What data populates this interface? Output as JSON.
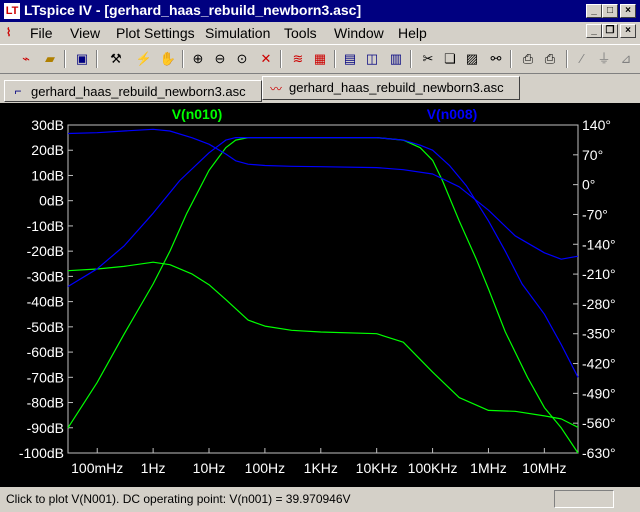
{
  "window": {
    "title": "LTspice IV - [gerhard_haas_rebuild_newborn3.asc]",
    "app_icon": "ltspice-logo-icon"
  },
  "menu": {
    "items": [
      {
        "label": "File"
      },
      {
        "label": "View"
      },
      {
        "label": "Plot Settings"
      },
      {
        "label": "Simulation"
      },
      {
        "label": "Tools"
      },
      {
        "label": "Window"
      },
      {
        "label": "Help"
      }
    ]
  },
  "toolbar": {
    "icons": [
      "new-schematic-icon",
      "open-icon",
      "save-icon",
      "control-panel-icon",
      "run-icon",
      "halt-icon",
      "zoom-in-icon",
      "zoom-out-icon",
      "zoom-back-icon",
      "zoom-extents-icon",
      "autorange-icon",
      "grid-icon",
      "tile-horizontal-icon",
      "cascade-icon",
      "tile-vertical-icon",
      "cut-icon",
      "copy-icon",
      "paste-icon",
      "find-icon",
      "print-setup-icon",
      "print-icon",
      "draw-wire-icon",
      "ground-icon",
      "label-net-icon"
    ]
  },
  "tabs": [
    {
      "label": "gerhard_haas_rebuild_newborn3.asc",
      "icon": "schematic-icon",
      "active": false
    },
    {
      "label": "gerhard_haas_rebuild_newborn3.asc",
      "icon": "waveform-icon",
      "active": true
    }
  ],
  "status": {
    "text": "Click to plot V(N001).  DC operating point: V(n001) = 39.970946V"
  },
  "colors": {
    "plot_background": "#000000",
    "axis_text": "#ffffff",
    "series_green": "#00ff00",
    "series_blue": "#0000ff",
    "title_bar": "#000080"
  },
  "chart_data": {
    "type": "line",
    "xscale": "log",
    "xlim": [
      0.03,
      40000000
    ],
    "ylim": [
      -100,
      30
    ],
    "y2lim": [
      -630,
      140
    ],
    "x_ticks": [
      {
        "v": 0.1,
        "label": "100mHz"
      },
      {
        "v": 1,
        "label": "1Hz"
      },
      {
        "v": 10,
        "label": "10Hz"
      },
      {
        "v": 100,
        "label": "100Hz"
      },
      {
        "v": 1000,
        "label": "1KHz"
      },
      {
        "v": 10000,
        "label": "10KHz"
      },
      {
        "v": 100000,
        "label": "100KHz"
      },
      {
        "v": 1000000,
        "label": "1MHz"
      },
      {
        "v": 10000000,
        "label": "10MHz"
      }
    ],
    "y_ticks": [
      {
        "v": 30,
        "label": "30dB"
      },
      {
        "v": 20,
        "label": "20dB"
      },
      {
        "v": 10,
        "label": "10dB"
      },
      {
        "v": 0,
        "label": "0dB"
      },
      {
        "v": -10,
        "label": "-10dB"
      },
      {
        "v": -20,
        "label": "-20dB"
      },
      {
        "v": -30,
        "label": "-30dB"
      },
      {
        "v": -40,
        "label": "-40dB"
      },
      {
        "v": -50,
        "label": "-50dB"
      },
      {
        "v": -60,
        "label": "-60dB"
      },
      {
        "v": -70,
        "label": "-70dB"
      },
      {
        "v": -80,
        "label": "-80dB"
      },
      {
        "v": -90,
        "label": "-90dB"
      },
      {
        "v": -100,
        "label": "-100dB"
      }
    ],
    "y2_ticks": [
      {
        "v": 140,
        "label": "140°"
      },
      {
        "v": 70,
        "label": "70°"
      },
      {
        "v": 0,
        "label": "0°"
      },
      {
        "v": -70,
        "label": "-70°"
      },
      {
        "v": -140,
        "label": "-140°"
      },
      {
        "v": -210,
        "label": "-210°"
      },
      {
        "v": -280,
        "label": "-280°"
      },
      {
        "v": -350,
        "label": "-350°"
      },
      {
        "v": -420,
        "label": "-420°"
      },
      {
        "v": -490,
        "label": "-490°"
      },
      {
        "v": -560,
        "label": "-560°"
      },
      {
        "v": -630,
        "label": "-630°"
      }
    ],
    "series": [
      {
        "name": "V(n010)",
        "color": "#00ff00",
        "magnitude": {
          "x": [
            0.03,
            0.1,
            0.3,
            1,
            2,
            4,
            10,
            20,
            30,
            50,
            100,
            300,
            1000,
            10000,
            30000,
            60000,
            100000,
            150000,
            300000,
            600000,
            1000000,
            2000000,
            5000000,
            10000000,
            20000000,
            40000000
          ],
          "y": [
            -90,
            -72,
            -53,
            -33,
            -20,
            -5,
            12,
            21,
            24,
            25,
            25,
            25,
            25,
            25,
            24,
            21,
            16,
            8,
            -8,
            -23,
            -35,
            -52,
            -70,
            -82,
            -90,
            -100
          ]
        },
        "phase": {
          "x": [
            0.03,
            0.1,
            0.3,
            1,
            2,
            5,
            10,
            20,
            50,
            100,
            300,
            1000,
            10000,
            30000,
            100000,
            300000,
            1000000,
            3000000,
            10000000,
            20000000,
            40000000
          ],
          "y": [
            -202,
            -198,
            -192,
            -182,
            -188,
            -210,
            -235,
            -270,
            -318,
            -332,
            -342,
            -346,
            -350,
            -370,
            -440,
            -500,
            -530,
            -532,
            -543,
            -550,
            -570
          ]
        }
      },
      {
        "name": "V(n008)",
        "color": "#0000ff",
        "magnitude": {
          "x": [
            0.03,
            0.1,
            0.3,
            1,
            3,
            10,
            20,
            30,
            50,
            100,
            300,
            1000,
            10000,
            30000,
            60000,
            100000,
            200000,
            400000,
            1000000,
            2000000,
            4000000,
            10000000,
            20000000,
            40000000
          ],
          "y": [
            -34,
            -27,
            -18,
            -5,
            8,
            19,
            24,
            25,
            25,
            25,
            25,
            25,
            25,
            24,
            22,
            20,
            14,
            6,
            -8,
            -20,
            -33,
            -45,
            -57,
            -70
          ]
        },
        "phase": {
          "x": [
            0.03,
            0.1,
            0.3,
            1,
            2,
            5,
            10,
            20,
            30,
            50,
            100,
            300,
            1000,
            10000,
            30000,
            100000,
            300000,
            1000000,
            3000000,
            10000000,
            20000000,
            40000000
          ],
          "y": [
            120,
            122,
            126,
            130,
            126,
            110,
            95,
            72,
            56,
            48,
            45,
            43,
            42,
            40,
            35,
            25,
            -5,
            -60,
            -120,
            -160,
            -175,
            -168
          ]
        }
      }
    ]
  }
}
